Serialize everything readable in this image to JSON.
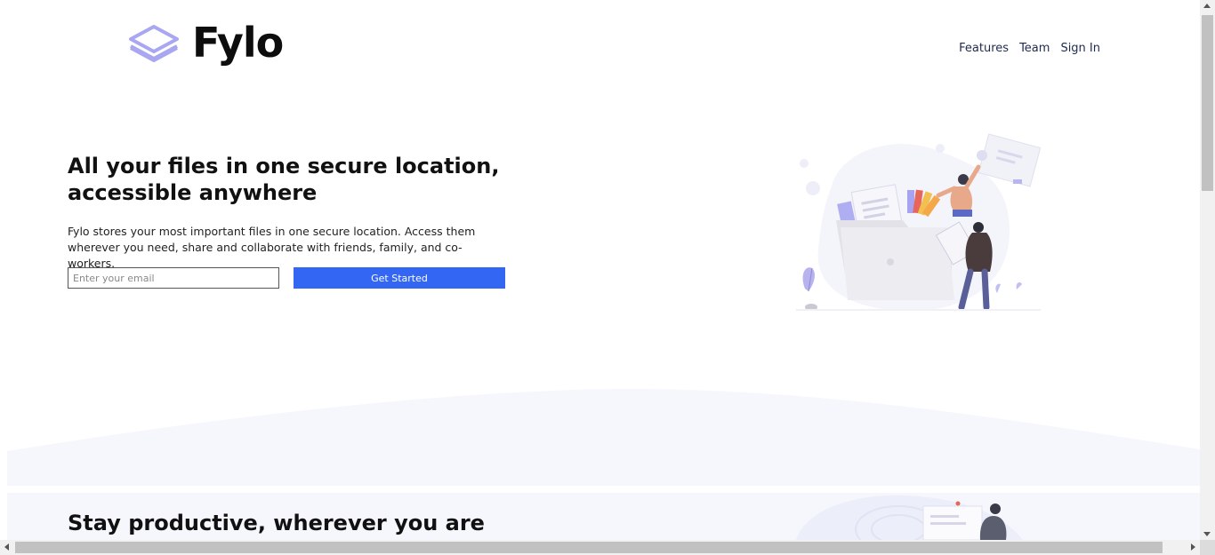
{
  "header": {
    "logo_text": "Fylo",
    "nav": [
      {
        "label": "Features"
      },
      {
        "label": "Team"
      },
      {
        "label": "Sign In"
      }
    ]
  },
  "hero": {
    "title": "All your files in one secure location, accessible anywhere",
    "description": "Fylo stores your most important files in one secure location. Access them wherever you need, share and collaborate with friends, family, and co-workers.",
    "email_placeholder": "Enter your email",
    "cta_label": "Get Started"
  },
  "section2": {
    "title": "Stay productive, wherever you are"
  },
  "colors": {
    "accent": "#3366f2",
    "logo_icon": "#a9a6f2",
    "section_bg": "#f6f7fd"
  }
}
